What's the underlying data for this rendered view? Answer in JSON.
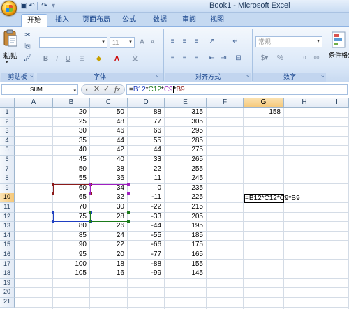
{
  "window": {
    "title": "Book1 - Microsoft Excel"
  },
  "quick_access": [
    "save-icon",
    "undo-icon",
    "redo-icon"
  ],
  "ribbon": {
    "tabs": [
      {
        "label": "开始",
        "active": true
      },
      {
        "label": "插入"
      },
      {
        "label": "页面布局"
      },
      {
        "label": "公式"
      },
      {
        "label": "数据"
      },
      {
        "label": "审阅"
      },
      {
        "label": "视图"
      }
    ],
    "groups": {
      "clipboard": {
        "label": "剪贴板",
        "paste_label": "粘贴"
      },
      "font": {
        "label": "字体",
        "font_size": "11",
        "bold": "B",
        "italic": "I",
        "underline": "U"
      },
      "alignment": {
        "label": "对齐方式"
      },
      "number": {
        "label": "数字",
        "format": "常规",
        "percent": "%"
      },
      "styles": {
        "label": "条件格式"
      }
    }
  },
  "formula_bar": {
    "name_box": "SUM",
    "cancel": "✕",
    "enter": "✓",
    "fx": "fx",
    "formula_parts": [
      "=",
      "B12",
      "*",
      "C12",
      "*",
      "C9",
      "*",
      "B9"
    ]
  },
  "sheet": {
    "columns": [
      "A",
      "B",
      "C",
      "D",
      "E",
      "F",
      "G",
      "H",
      "I"
    ],
    "active_column": "G",
    "active_row": 10,
    "rows": [
      {
        "n": "1",
        "B": "20",
        "C": "50",
        "D": "88",
        "E": "315",
        "G": "158"
      },
      {
        "n": "2",
        "B": "25",
        "C": "48",
        "D": "77",
        "E": "305"
      },
      {
        "n": "3",
        "B": "30",
        "C": "46",
        "D": "66",
        "E": "295"
      },
      {
        "n": "4",
        "B": "35",
        "C": "44",
        "D": "55",
        "E": "285"
      },
      {
        "n": "5",
        "B": "40",
        "C": "42",
        "D": "44",
        "E": "275"
      },
      {
        "n": "6",
        "B": "45",
        "C": "40",
        "D": "33",
        "E": "265"
      },
      {
        "n": "7",
        "B": "50",
        "C": "38",
        "D": "22",
        "E": "255"
      },
      {
        "n": "8",
        "B": "55",
        "C": "36",
        "D": "11",
        "E": "245"
      },
      {
        "n": "9",
        "B": "60",
        "C": "34",
        "D": "0",
        "E": "235"
      },
      {
        "n": "10",
        "B": "65",
        "C": "32",
        "D": "-11",
        "E": "225",
        "G": "=B12*C12*C9*B9"
      },
      {
        "n": "11",
        "B": "70",
        "C": "30",
        "D": "-22",
        "E": "215"
      },
      {
        "n": "12",
        "B": "75",
        "C": "28",
        "D": "-33",
        "E": "205"
      },
      {
        "n": "13",
        "B": "80",
        "C": "26",
        "D": "-44",
        "E": "195"
      },
      {
        "n": "14",
        "B": "85",
        "C": "24",
        "D": "-55",
        "E": "185"
      },
      {
        "n": "15",
        "B": "90",
        "C": "22",
        "D": "-66",
        "E": "175"
      },
      {
        "n": "16",
        "B": "95",
        "C": "20",
        "D": "-77",
        "E": "165"
      },
      {
        "n": "17",
        "B": "100",
        "C": "18",
        "D": "-88",
        "E": "155"
      },
      {
        "n": "18",
        "B": "105",
        "C": "16",
        "D": "-99",
        "E": "145"
      },
      {
        "n": "19"
      },
      {
        "n": "20"
      },
      {
        "n": "21"
      }
    ],
    "reference_colors": {
      "B12": "#1f3fc1",
      "C12": "#1b7a1b",
      "C9": "#a020c0",
      "B9": "#8b1a1a"
    }
  }
}
